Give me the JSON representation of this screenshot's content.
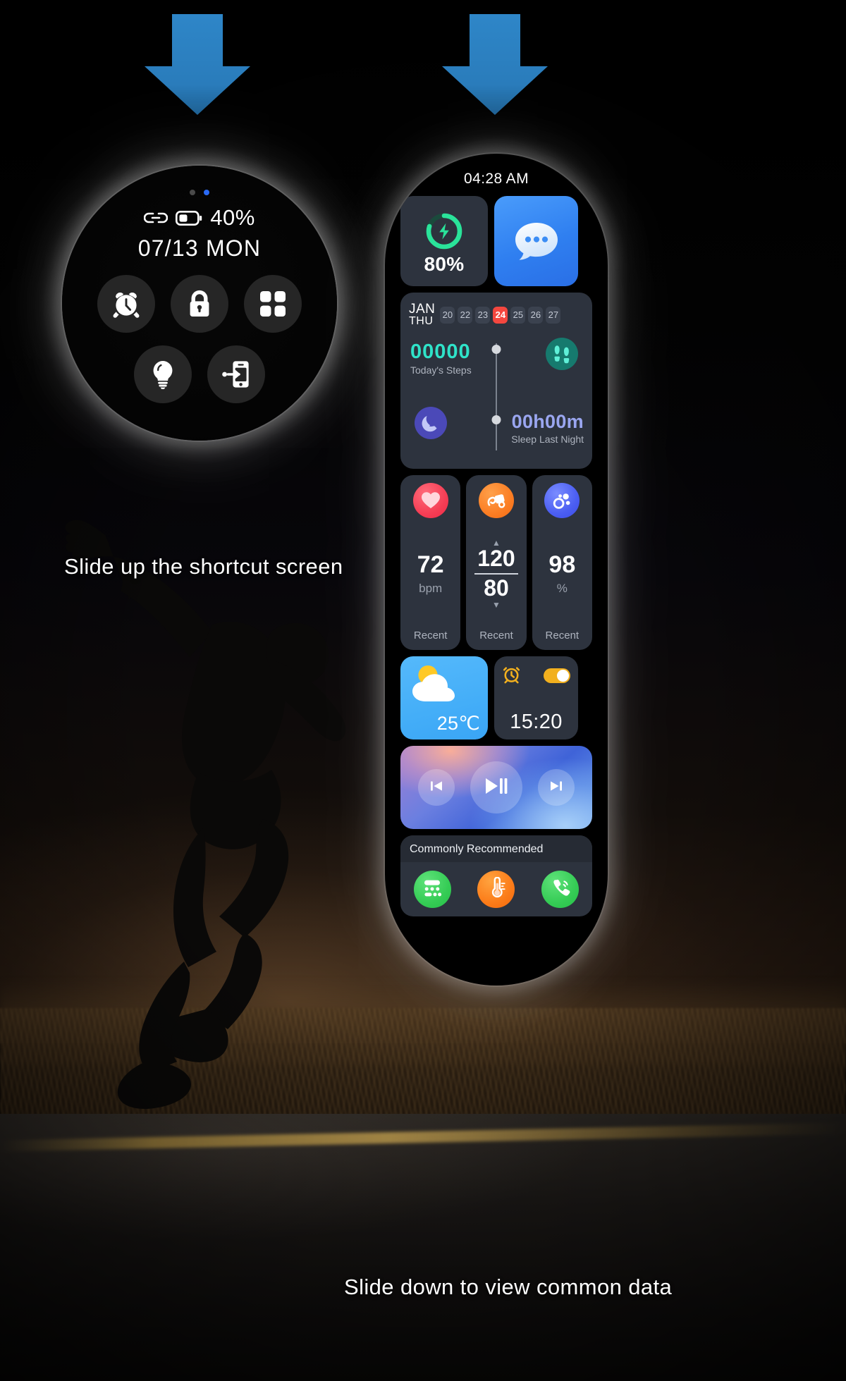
{
  "arrows": {
    "left_arrow_name": "down-arrow-left",
    "right_arrow_name": "down-arrow-right",
    "color": "#2c84c4"
  },
  "captions": {
    "left": "Slide up the shortcut screen",
    "right": "Slide down to view common data"
  },
  "shortcut_watch": {
    "page_dots": [
      {
        "active": false
      },
      {
        "active": true
      }
    ],
    "status": {
      "link_icon": "link-icon",
      "battery_icon": "battery-icon",
      "battery_percent": "40%"
    },
    "date": "07/13 MON",
    "shortcuts_row1": [
      {
        "name": "alarm-shortcut",
        "icon": "alarm-clock-icon"
      },
      {
        "name": "lock-shortcut",
        "icon": "lock-icon"
      },
      {
        "name": "apps-shortcut",
        "icon": "apps-grid-icon"
      }
    ],
    "shortcuts_row2": [
      {
        "name": "brightness-shortcut",
        "icon": "light-bulb-icon"
      },
      {
        "name": "find-phone-shortcut",
        "icon": "find-phone-icon"
      }
    ]
  },
  "data_watch": {
    "time": "04:28 AM",
    "battery_widget": {
      "name": "battery-widget",
      "icon": "charging-bolt-icon",
      "percent": "80%",
      "ring_value": 80,
      "ring_color": "#2ae39a"
    },
    "message_widget": {
      "name": "messages-widget",
      "icon": "chat-bubble-icon",
      "color": "#3b8df5"
    },
    "activity_widget": {
      "month": "JAN",
      "weekday": "THU",
      "days": [
        {
          "label": "20",
          "active": false
        },
        {
          "label": "22",
          "active": false
        },
        {
          "label": "23",
          "active": false
        },
        {
          "label": "24",
          "active": true
        },
        {
          "label": "25",
          "active": false
        },
        {
          "label": "26",
          "active": false
        },
        {
          "label": "27",
          "active": false
        }
      ],
      "active_day_color": "#f4473f",
      "steps_value": "00000",
      "steps_label": "Today's Steps",
      "steps_color": "#2fe3c9",
      "steps_icon": "footprints-icon",
      "sleep_value": "00h00m",
      "sleep_label": "Sleep Last Night",
      "sleep_color": "#9aa6f0",
      "sleep_icon": "moon-sleep-icon"
    },
    "health": [
      {
        "name": "heart-rate-card",
        "icon": "heart-icon",
        "value": "72",
        "unit": "bpm",
        "footer": "Recent",
        "color": "#f53e55"
      },
      {
        "name": "blood-pressure-card",
        "icon": "blood-pressure-icon",
        "systolic": "120",
        "diastolic": "80",
        "footer": "Recent",
        "color": "#fb7e24"
      },
      {
        "name": "blood-oxygen-card",
        "icon": "blood-oxygen-icon",
        "value": "98",
        "unit": "%",
        "footer": "Recent",
        "color": "#4b5ef2"
      }
    ],
    "weather_widget": {
      "name": "weather-widget",
      "icon": "sun-cloud-icon",
      "temperature": "25℃",
      "color": "#44aef8"
    },
    "alarm_widget": {
      "name": "alarm-widget",
      "icon": "alarm-clock-icon",
      "toggle_on": true,
      "toggle_color": "#f2b01e",
      "time": "15:20"
    },
    "media_widget": {
      "name": "media-player-widget",
      "prev_icon": "previous-track-icon",
      "play_icon": "play-pause-icon",
      "next_icon": "next-track-icon"
    },
    "recommended": {
      "title": "Commonly Recommended",
      "apps": [
        {
          "name": "calculator-app",
          "icon": "calculator-icon",
          "color": "#35cc55"
        },
        {
          "name": "thermometer-app",
          "icon": "thermometer-icon",
          "color": "#fb7c19"
        },
        {
          "name": "phone-app",
          "icon": "phone-icon",
          "color": "#35cc55"
        }
      ]
    }
  }
}
